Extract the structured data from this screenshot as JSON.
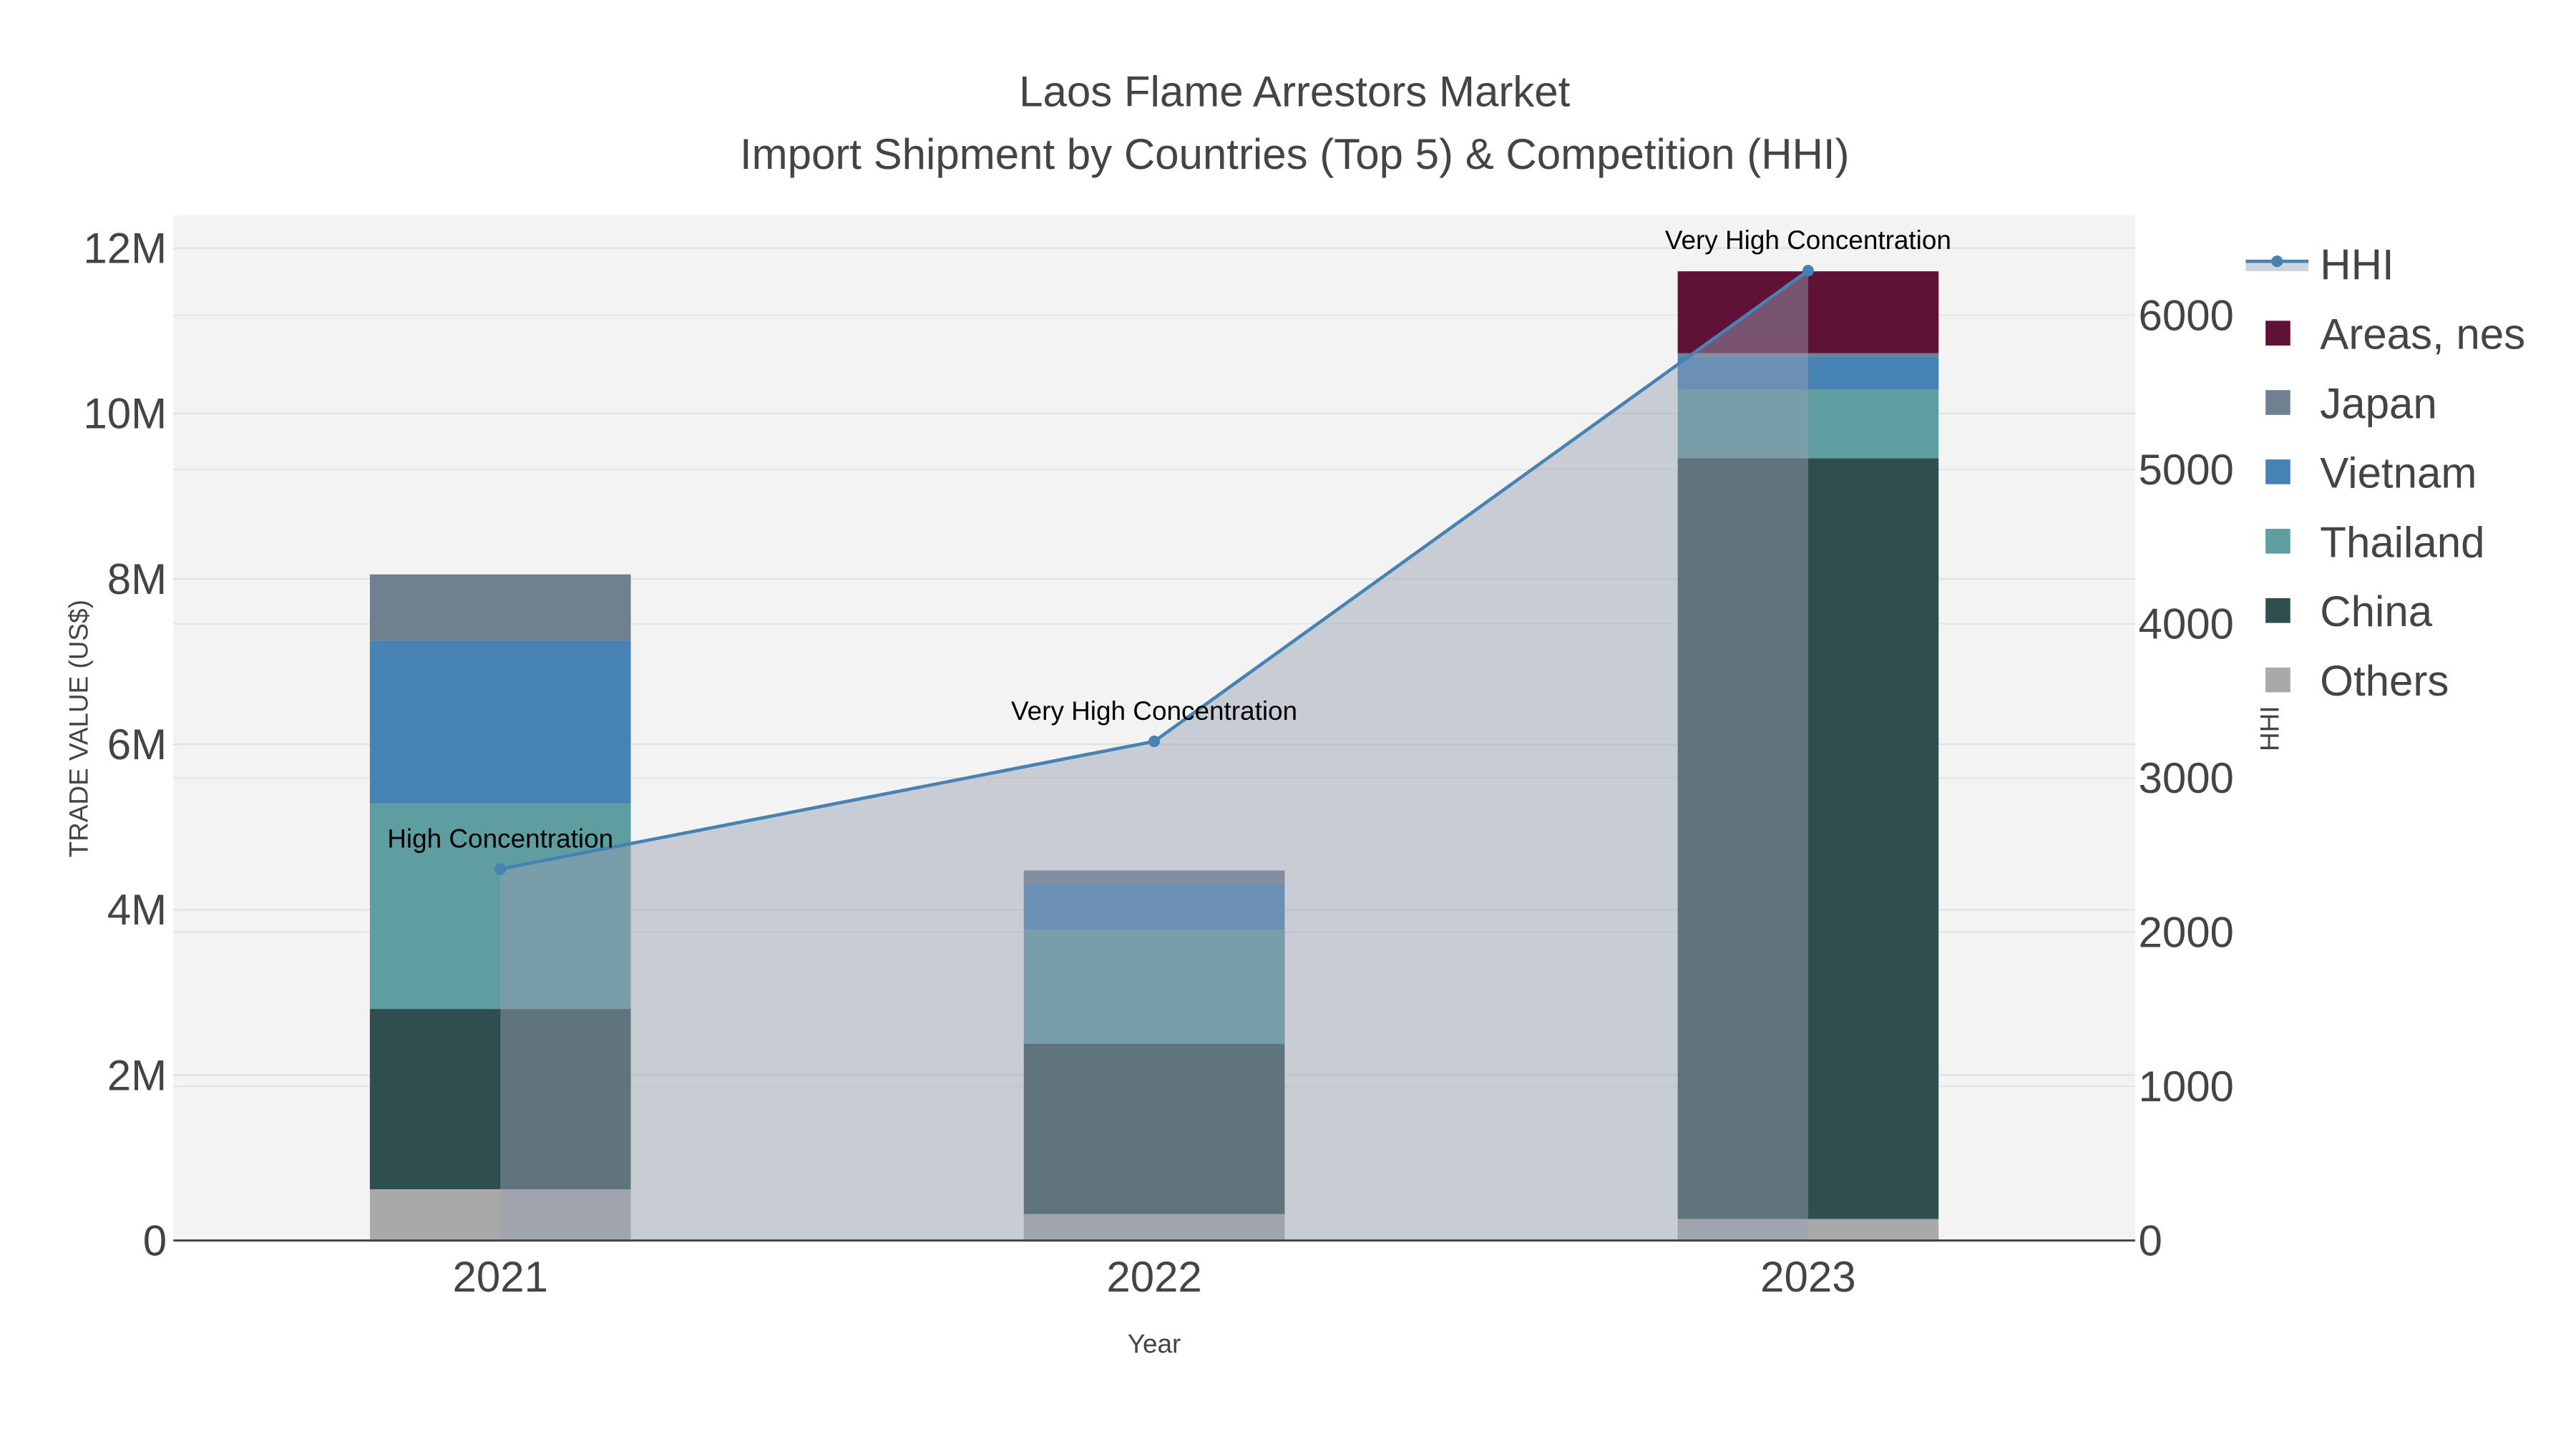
{
  "chart_data": {
    "type": "bar",
    "barmode": "stack",
    "title": "Laos Flame Arrestors Market",
    "subtitle": "Import Shipment by Countries (Top 5) & Competition (HHI)",
    "xlabel": "Year",
    "ylabel": "TRADE VALUE (US$)",
    "y2label": "HHI",
    "categories": [
      "2021",
      "2022",
      "2023"
    ],
    "ylim": [
      0,
      12400000
    ],
    "y2lim": [
      0,
      6650
    ],
    "yticks": [
      {
        "v": 0,
        "label": "0"
      },
      {
        "v": 2000000,
        "label": "2M"
      },
      {
        "v": 4000000,
        "label": "4M"
      },
      {
        "v": 6000000,
        "label": "6M"
      },
      {
        "v": 8000000,
        "label": "8M"
      },
      {
        "v": 10000000,
        "label": "10M"
      },
      {
        "v": 12000000,
        "label": "12M"
      }
    ],
    "y2ticks": [
      {
        "v": 0,
        "label": "0"
      },
      {
        "v": 1000,
        "label": "1000"
      },
      {
        "v": 2000,
        "label": "2000"
      },
      {
        "v": 3000,
        "label": "3000"
      },
      {
        "v": 4000,
        "label": "4000"
      },
      {
        "v": 5000,
        "label": "5000"
      },
      {
        "v": 6000,
        "label": "6000"
      }
    ],
    "series": [
      {
        "name": "Others",
        "color": "#a9a9a9",
        "values": [
          620000,
          320000,
          260000
        ]
      },
      {
        "name": "China",
        "color": "#2f4f4f",
        "values": [
          2180000,
          2060000,
          9200000
        ]
      },
      {
        "name": "Thailand",
        "color": "#5f9ea0",
        "values": [
          2485000,
          1375000,
          830000
        ]
      },
      {
        "name": "Vietnam",
        "color": "#4682b4",
        "values": [
          1970000,
          560000,
          400000
        ]
      },
      {
        "name": "Japan",
        "color": "#708090",
        "values": [
          800000,
          160000,
          40000
        ]
      },
      {
        "name": "Areas, nes",
        "color": "#5f1235",
        "values": [
          0,
          0,
          990000
        ]
      }
    ],
    "hhi": {
      "name": "HHI",
      "color": "#4682b4",
      "values": [
        2409,
        3237,
        6290
      ],
      "annotations": [
        "High Concentration",
        "Very High Concentration",
        "Very High Concentration"
      ]
    },
    "legend": [
      "HHI",
      "Areas, nes",
      "Japan",
      "Vietnam",
      "Thailand",
      "China",
      "Others"
    ],
    "legend_position": "right",
    "grid": true
  }
}
